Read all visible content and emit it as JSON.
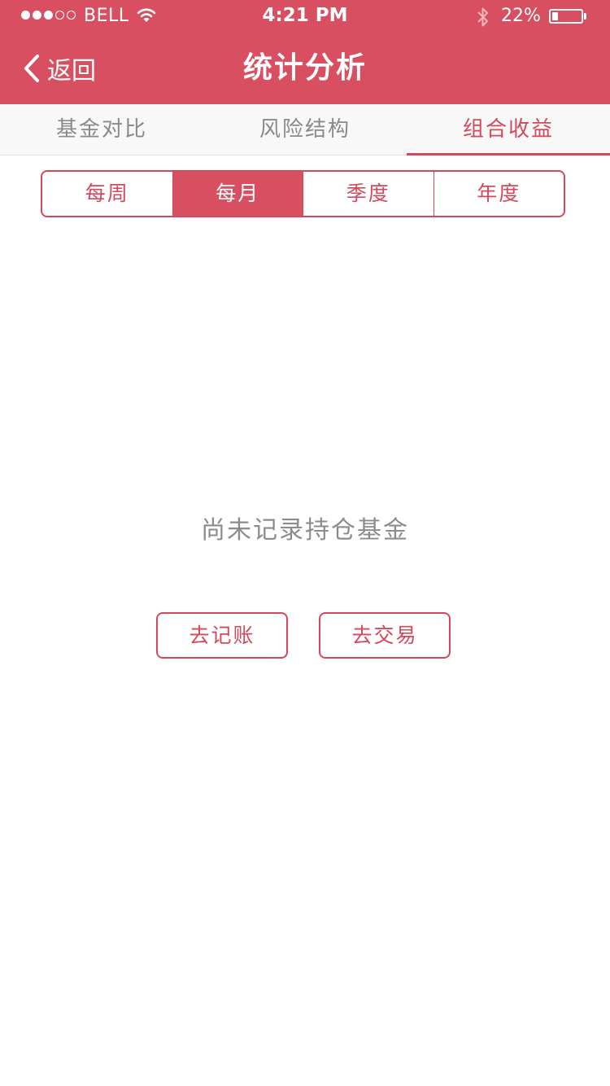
{
  "status_bar": {
    "signal_bars": [
      true,
      true,
      true,
      false,
      false
    ],
    "carrier": "BELL",
    "time": "4:21 PM",
    "battery_percent_label": "22%",
    "battery_level": 0.22,
    "icons": [
      "signal-dots-icon",
      "wifi-icon",
      "bluetooth-icon",
      "battery-icon"
    ]
  },
  "nav": {
    "back_label": "返回",
    "title": "统计分析",
    "back_icon": "chevron-left-icon"
  },
  "top_tabs": [
    {
      "label": "基金对比",
      "active": false
    },
    {
      "label": "风险结构",
      "active": false
    },
    {
      "label": "组合收益",
      "active": true
    }
  ],
  "period_segments": [
    {
      "label": "每周",
      "active": false
    },
    {
      "label": "每月",
      "active": true
    },
    {
      "label": "季度",
      "active": false
    },
    {
      "label": "年度",
      "active": false
    }
  ],
  "empty_state": {
    "message": "尚未记录持仓基金",
    "record_button_label": "去记账",
    "trade_button_label": "去交易"
  },
  "colors": {
    "brand": "#d94f62",
    "accent_text": "#d5485b",
    "muted_text": "#8c8c8c"
  }
}
